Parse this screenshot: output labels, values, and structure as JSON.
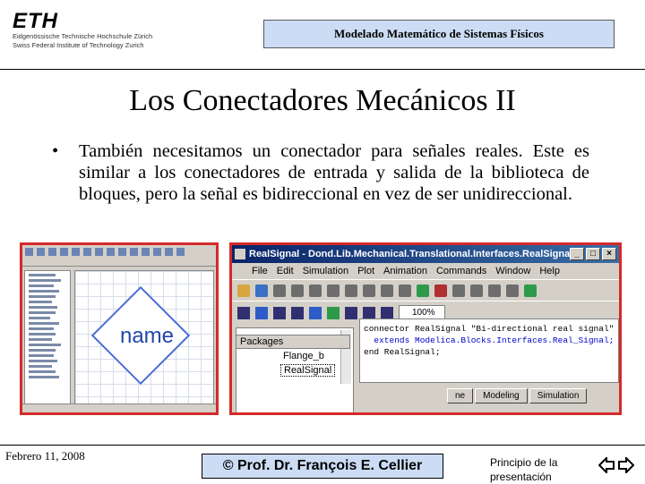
{
  "header": {
    "logo": "ETH",
    "institution_de": "Eidgenössische Technische Hochschule Zürich",
    "institution_en": "Swiss Federal Institute of Technology Zurich",
    "course": "Modelado Matemático de Sistemas Físicos"
  },
  "slide": {
    "title": "Los Conectadores Mecánicos II",
    "bullet_mark": "•",
    "bullet": "También necesitamos un conectador para señales reales. Este es similar a los conectadores de entrada y salida de la biblioteca de bloques, pero la señal es bidireccional en vez de ser unidireccional."
  },
  "screenshot_left": {
    "icon_text": "name"
  },
  "screenshot_right": {
    "window_title": "RealSignal - Dond.Lib.Mechanical.Translational.Interfaces.RealSignal - [Modelica Te...",
    "window_buttons": [
      "_",
      "□",
      "×"
    ],
    "menu": [
      "File",
      "Edit",
      "Simulation",
      "Plot",
      "Animation",
      "Commands",
      "Window",
      "Help"
    ],
    "zoom": "100%",
    "packages_label": "Packages",
    "tree_items": [
      "Flange_b",
      "RealSignal"
    ],
    "code_lines": [
      "connector RealSignal \"Bi-directional real signal\"",
      "  extends Modelica.Blocks.Interfaces.Real_Signal;",
      "",
      "end RealSignal;"
    ],
    "tabs": [
      "ne",
      "Modeling",
      "Simulation"
    ]
  },
  "footer": {
    "date": "Febrero 11, 2008",
    "author": "© Prof. Dr. François E. Cellier",
    "pres_link": "Principio de la presentación"
  }
}
